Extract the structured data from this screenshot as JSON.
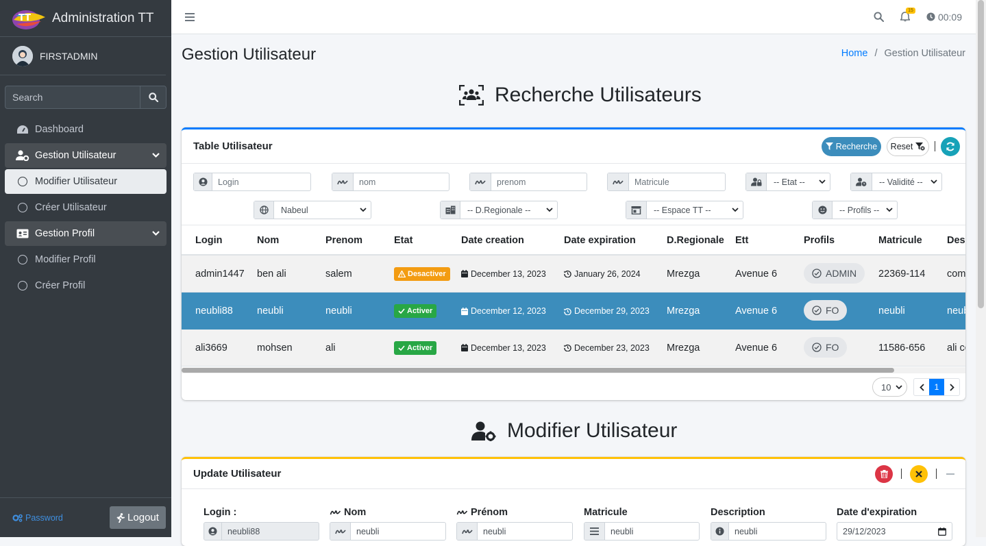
{
  "app": {
    "title": "Administration TT"
  },
  "user": {
    "name": "FIRSTADMIN"
  },
  "sidebar": {
    "search_placeholder": "Search",
    "items": [
      {
        "label": "Dashboard"
      },
      {
        "label": "Gestion Utilisateur"
      },
      {
        "label": "Modifier Utilisateur"
      },
      {
        "label": "Créer Utilisateur"
      },
      {
        "label": "Gestion Profil"
      },
      {
        "label": "Modifier Profil"
      },
      {
        "label": "Créer Profil"
      }
    ],
    "password_label": "Password",
    "logout_label": "Logout"
  },
  "topbar": {
    "notification_count": "15",
    "time": "00:09"
  },
  "page": {
    "title": "Gestion Utilisateur",
    "breadcrumb_home": "Home",
    "breadcrumb_sep": "/",
    "breadcrumb_current": "Gestion Utilisateur"
  },
  "search_section": {
    "heading": "Recherche Utilisateurs",
    "card_title": "Table Utilisateur",
    "btn_recherche": "Recherche",
    "btn_reset": "Reset",
    "separator": "|",
    "filters": {
      "login": "Login",
      "nom": "nom",
      "prenom": "prenom",
      "matricule": "Matricule",
      "etat": "-- Etat --",
      "validite": "-- Validité --",
      "region": "Nabeul",
      "dregionale": "-- D.Regionale --",
      "espace": "-- Espace TT --",
      "profils": "-- Profils --"
    },
    "columns": [
      "Login",
      "Nom",
      "Prenom",
      "Etat",
      "Date creation",
      "Date expiration",
      "D.Regionale",
      "Ett",
      "Profils",
      "Matricule",
      "Desc"
    ],
    "rows": [
      {
        "login": "admin1447",
        "nom": "ben ali",
        "prenom": "salem",
        "etat": "Desactiver",
        "created": "December 13, 2023",
        "expires": "January 26, 2024",
        "dreg": "Mrezga",
        "ett": "Avenue 6",
        "profil": "ADMIN",
        "matricule": "22369-114",
        "desc": "com"
      },
      {
        "login": "neubli88",
        "nom": "neubli",
        "prenom": "neubli",
        "etat": "Activer",
        "created": "December 12, 2023",
        "expires": "December 29, 2023",
        "dreg": "Mrezga",
        "ett": "Avenue 6",
        "profil": "FO",
        "matricule": "neubli",
        "desc": "neub"
      },
      {
        "login": "ali3669",
        "nom": "mohsen",
        "prenom": "ali",
        "etat": "Activer",
        "created": "December 13, 2023",
        "expires": "December 23, 2023",
        "dreg": "Mrezga",
        "ett": "Avenue 6",
        "profil": "FO",
        "matricule": "11586-656",
        "desc": "ali co"
      }
    ],
    "page_size": "10",
    "current_page": "1"
  },
  "update_section": {
    "heading": "Modifier Utilisateur",
    "card_title": "Update Utilisateur",
    "separator": "|",
    "labels": {
      "login": "Login :",
      "nom": "Nom",
      "prenom": "Prénom",
      "matricule": "Matricule",
      "description": "Description",
      "date_exp": "Date d'expiration"
    },
    "values": {
      "login": "neubli88",
      "nom": "neubli",
      "prenom": "neubli",
      "matricule": "neubli",
      "description": "neubli",
      "date_exp": "29/12/2023"
    }
  },
  "colors": {
    "sidebar": "#343a40",
    "primary": "#007bff",
    "selected_row": "#3c8dbc",
    "warning": "#f39c12",
    "success": "#28a745",
    "info": "#17a2b8",
    "danger": "#dc3545",
    "update_border": "#ffc107"
  }
}
